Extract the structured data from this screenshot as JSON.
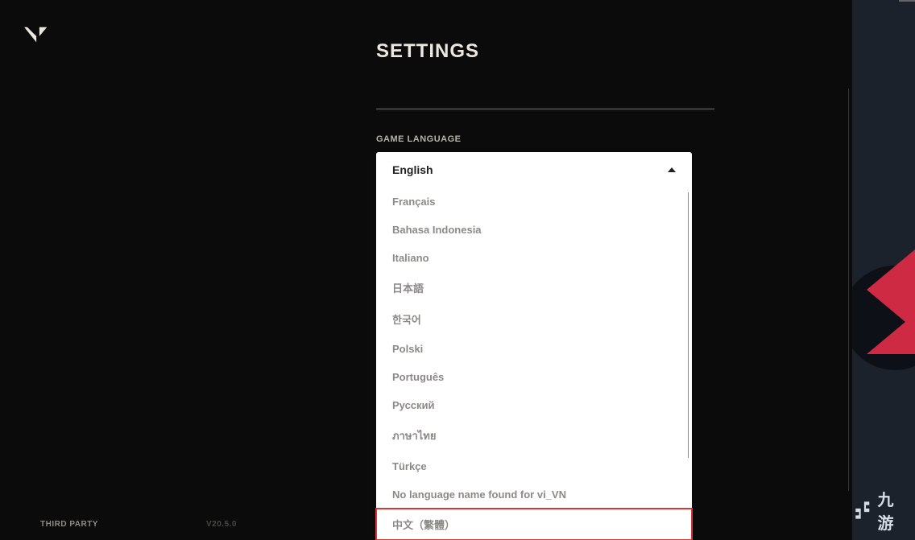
{
  "header": {
    "title": "SETTINGS"
  },
  "section": {
    "label": "GAME LANGUAGE"
  },
  "dropdown": {
    "selected": "English",
    "options": [
      "Français",
      "Bahasa Indonesia",
      "Italiano",
      "日本語",
      "한국어",
      "Polski",
      "Português",
      "Русский",
      "ภาษาไทย",
      "Türkçe",
      "No language name found for vi_VN",
      "中文（繁體）"
    ],
    "highlighted": "中文（繁體）"
  },
  "footer": {
    "third_party": "THIRD PARTY",
    "version": "V20.5.0"
  },
  "watermark": {
    "text": "九游"
  }
}
